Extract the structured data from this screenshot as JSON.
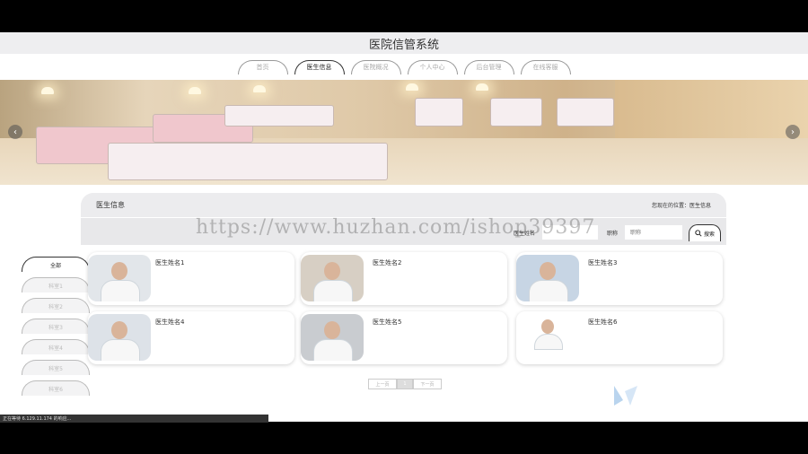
{
  "site": {
    "title": "医院信管系统"
  },
  "nav": {
    "tabs": [
      {
        "label": "首页",
        "active": false
      },
      {
        "label": "医生信息",
        "active": true
      },
      {
        "label": "医院概况",
        "active": false
      },
      {
        "label": "个人中心",
        "active": false
      },
      {
        "label": "后台管理",
        "active": false
      },
      {
        "label": "在线客服",
        "active": false
      }
    ]
  },
  "banner": {
    "prev_icon": "chevron-left-icon",
    "next_icon": "chevron-right-icon"
  },
  "section": {
    "title": "医生信息",
    "location": "您现在的位置：医生信息"
  },
  "search": {
    "name_label": "医生姓名",
    "name_value": "",
    "title_label": "职称",
    "title_placeholder": "职称",
    "button_label": "搜索",
    "button_icon": "search-icon"
  },
  "watermark": "https://www.huzhan.com/ishop39397",
  "categories": [
    {
      "label": "全部",
      "active": true
    },
    {
      "label": "科室1",
      "active": false
    },
    {
      "label": "科室2",
      "active": false
    },
    {
      "label": "科室3",
      "active": false
    },
    {
      "label": "科室4",
      "active": false
    },
    {
      "label": "科室5",
      "active": false
    },
    {
      "label": "科室6",
      "active": false
    }
  ],
  "doctors": [
    {
      "name": "医生姓名1"
    },
    {
      "name": "医生姓名2"
    },
    {
      "name": "医生姓名3"
    },
    {
      "name": "医生姓名4"
    },
    {
      "name": "医生姓名5"
    },
    {
      "name": "医生姓名6"
    }
  ],
  "pagination": {
    "prev": "上一页",
    "current": "1",
    "next": "下一页"
  },
  "status": {
    "text": "正在等待 6.129.11.174 的响应..."
  },
  "colors": {
    "active_border": "#333333",
    "page_bg": "#ffffff",
    "header_bg": "#eeeef0"
  }
}
